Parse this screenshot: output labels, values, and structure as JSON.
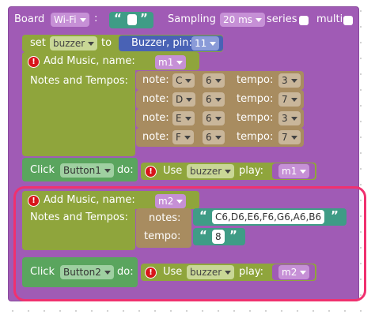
{
  "colors": {
    "purple": "#a05bb5",
    "olive": "#8fa53c",
    "green": "#5aa55e",
    "brown": "#a88c60",
    "teal": "#3f9c86",
    "blue": "#4962b5",
    "highlight": "#f0316f",
    "warning": "#d8151a"
  },
  "board": {
    "label": "Board",
    "connection": "Wi-Fi",
    "colon": ":",
    "sampling_label": "Sampling",
    "sampling_value": "20 ms",
    "series_label": "series",
    "multi_label": "multi"
  },
  "set_block": {
    "set_label": "set",
    "variable": "buzzer",
    "to_label": "to",
    "device_label": "Buzzer, pin:",
    "pin": "11"
  },
  "music1": {
    "add_label": "Add Music, name:",
    "name": "m1",
    "notes_tempos_label": "Notes and Tempos:",
    "notes": [
      {
        "note_label": "note:",
        "note": "C",
        "octave": "6",
        "tempo_label": "tempo:",
        "tempo": "3"
      },
      {
        "note_label": "note:",
        "note": "D",
        "octave": "6",
        "tempo_label": "tempo:",
        "tempo": "7"
      },
      {
        "note_label": "note:",
        "note": "E",
        "octave": "6",
        "tempo_label": "tempo:",
        "tempo": "3"
      },
      {
        "note_label": "note:",
        "note": "F",
        "octave": "6",
        "tempo_label": "tempo:",
        "tempo": "7"
      }
    ]
  },
  "click1": {
    "click_label": "Click",
    "button": "Button1",
    "do_label": "do:",
    "use_label": "Use",
    "variable": "buzzer",
    "play_label": "play:",
    "music": "m1"
  },
  "music2": {
    "add_label": "Add Music, name:",
    "name": "m2",
    "notes_tempos_label": "Notes and Tempos:",
    "notes_label": "notes:",
    "notes_value": "C6,D6,E6,F6,G6,A6,B6",
    "tempo_label": "tempo:",
    "tempo_value": "8"
  },
  "click2": {
    "click_label": "Click",
    "button": "Button2",
    "do_label": "do:",
    "use_label": "Use",
    "variable": "buzzer",
    "play_label": "play:",
    "music": "m2"
  },
  "icons": {
    "warning": "!",
    "open_quote": "“",
    "close_quote": "”"
  }
}
